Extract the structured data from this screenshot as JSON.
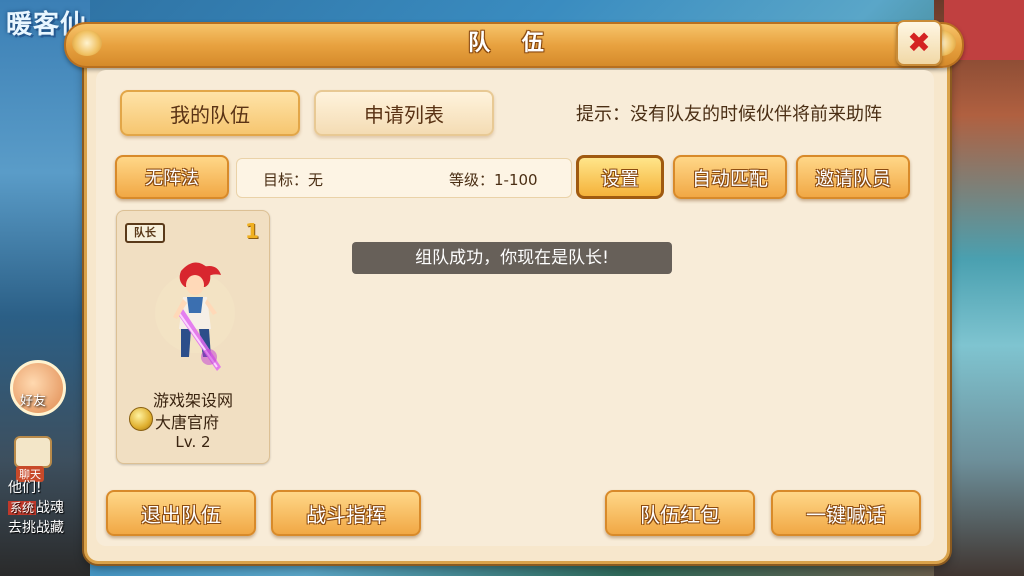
{
  "background": {
    "logo_text": "暖客仙",
    "friend_label": "好友",
    "chat_label": "聊天",
    "chat_lines": [
      "他们!",
      "去挑战藏"
    ],
    "chat_system_tag": "系统",
    "chat_system_text": "战魂"
  },
  "window": {
    "title": "队 伍",
    "close_glyph": "✖"
  },
  "tabs": {
    "my_team": "我的队伍",
    "apply_list": "申请列表"
  },
  "hint": "提示：没有队友的时候伙伴将前来助阵",
  "formation_button": "无阵法",
  "team_info": {
    "target": "目标：无",
    "level": "等级：1-100"
  },
  "actions": {
    "settings": "设置",
    "auto_match": "自动匹配",
    "invite": "邀请队员"
  },
  "member": {
    "badge": "队长",
    "slot": "1",
    "name": "游戏架设网",
    "school": "大唐官府",
    "level": "Lv. 2"
  },
  "toast": "组队成功，你现在是队长!",
  "bottom": {
    "leave": "退出队伍",
    "battle_command": "战斗指挥",
    "red_packet": "队伍红包",
    "shout": "一键喊话"
  },
  "colors": {
    "panel_bg": "#f7e7cc",
    "title_bar": "#e8a240",
    "button_orange": "#f1a845",
    "close_red": "#d42222"
  }
}
